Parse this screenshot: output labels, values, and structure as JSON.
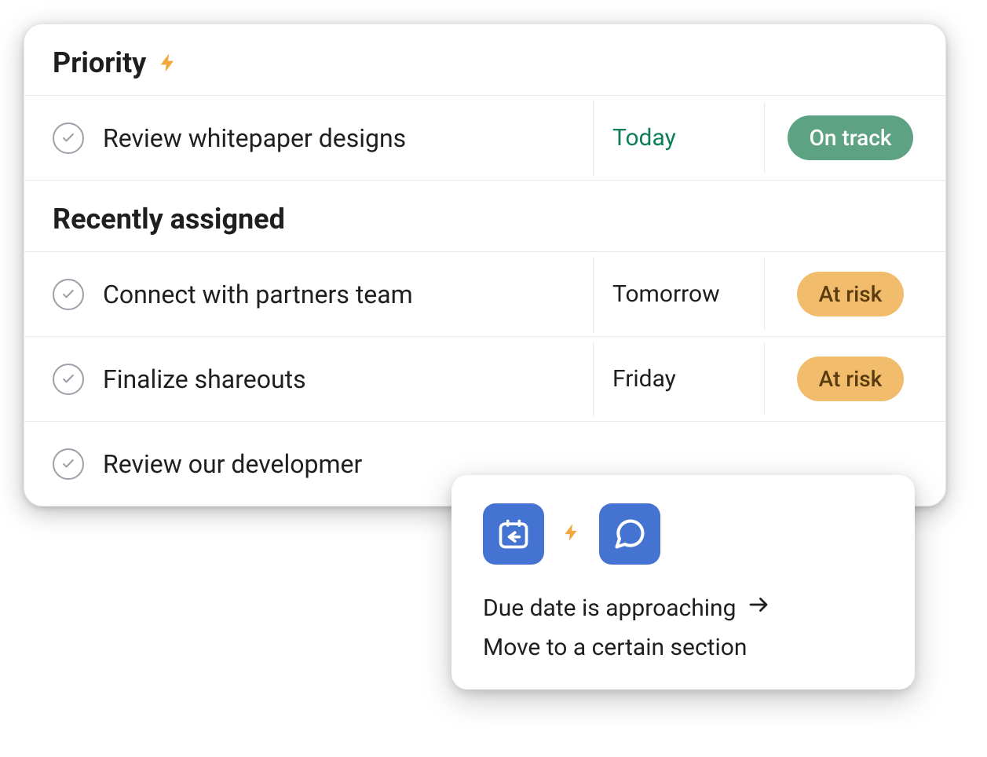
{
  "sections": {
    "priority": {
      "title": "Priority",
      "tasks": [
        {
          "name": "Review whitepaper designs",
          "date": "Today",
          "date_style": "today",
          "status": "On track",
          "status_style": "on-track"
        }
      ]
    },
    "recently_assigned": {
      "title": "Recently assigned",
      "tasks": [
        {
          "name": "Connect with partners team",
          "date": "Tomorrow",
          "date_style": "normal",
          "status": "At risk",
          "status_style": "at-risk"
        },
        {
          "name": "Finalize shareouts",
          "date": "Friday",
          "date_style": "normal",
          "status": "At risk",
          "status_style": "at-risk"
        },
        {
          "name": "Review our developmer",
          "date": "",
          "date_style": "",
          "status": "",
          "status_style": ""
        }
      ]
    }
  },
  "popup": {
    "line1": "Due date is approaching",
    "line2": "Move to a certain section"
  },
  "colors": {
    "lightning": "#f2a73b",
    "on_track_bg": "#5da283",
    "at_risk_bg": "#f1bd6c",
    "today_text": "#0d7f56",
    "icon_tile_bg": "#4573d2"
  }
}
